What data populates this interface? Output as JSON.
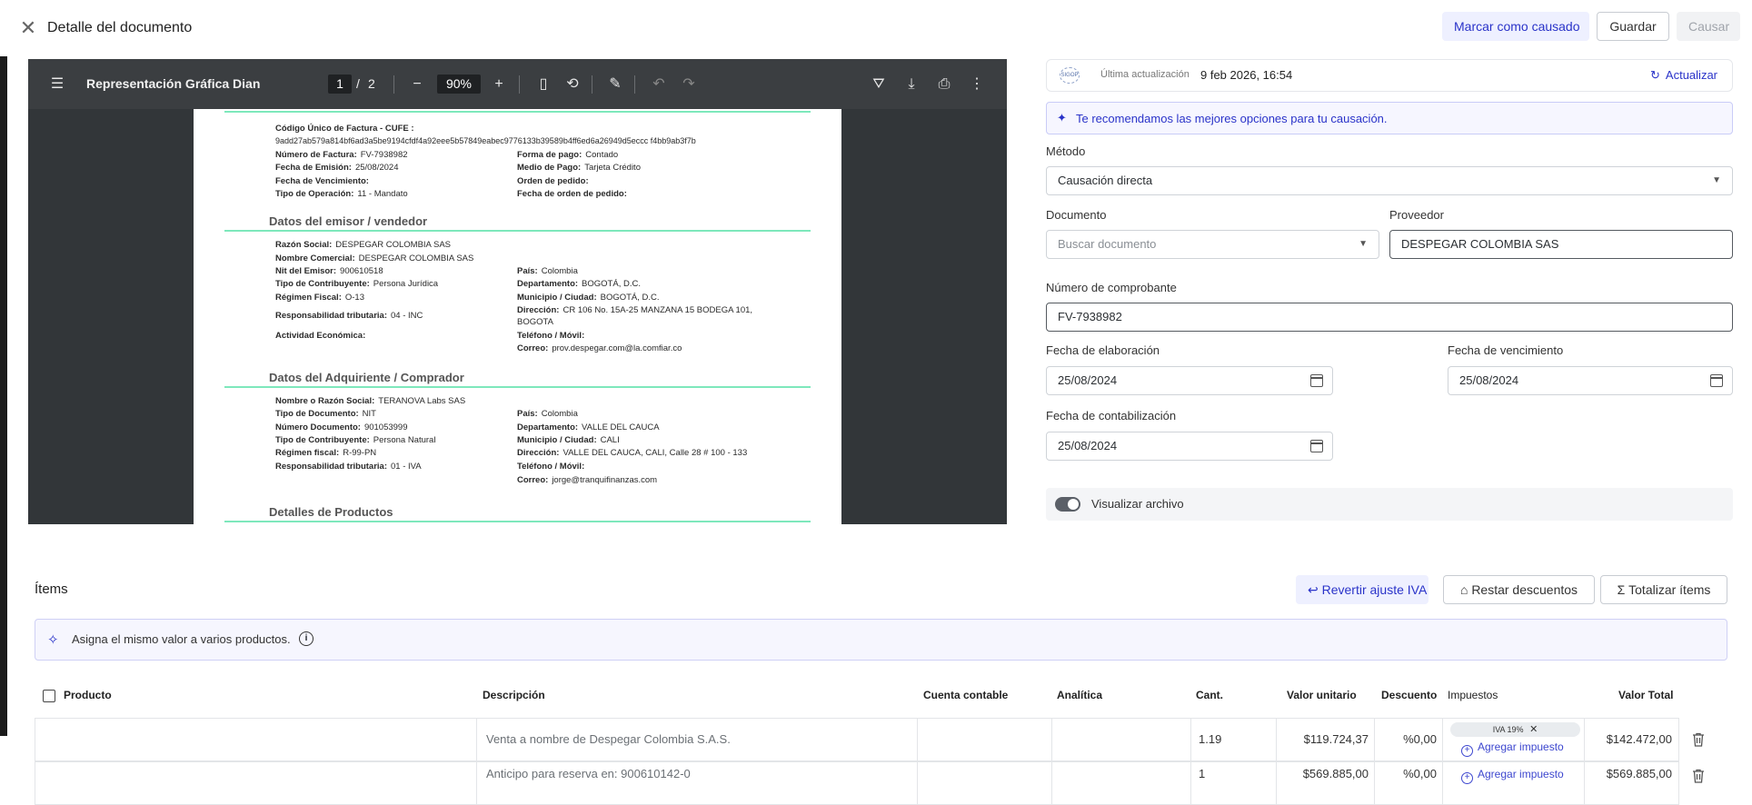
{
  "header": {
    "title": "Detalle del documento",
    "mark_label": "Marcar como causado",
    "save_label": "Guardar",
    "causar_label": "Causar"
  },
  "pdf": {
    "title": "Representación Gráfica Dian",
    "page_current": "1",
    "page_sep": "/",
    "page_total": "2",
    "zoom": "90%",
    "content": {
      "cufe_label": "Código Único de Factura - CUFE :",
      "cufe_value": "9add27ab579a814bf6ad3a5be9194cfdf4a92eee5b57849eabec9776133b39589b4ff6ed6a26949d5eccc f4bb9ab3f7b",
      "num_factura_label": "Número de Factura:",
      "num_factura_value": "FV-7938982",
      "forma_pago_label": "Forma de pago:",
      "forma_pago_value": "Contado",
      "fecha_emision_label": "Fecha de Emisión:",
      "fecha_emision_value": "25/08/2024",
      "medio_pago_label": "Medio de Pago:",
      "medio_pago_value": "Tarjeta Crédito",
      "fecha_venc_label": "Fecha de Vencimiento:",
      "orden_pedido_label": "Orden de pedido:",
      "tipo_operacion_label": "Tipo de Operación:",
      "tipo_operacion_value": "11 - Mandato",
      "fecha_orden_label": "Fecha de orden de pedido:",
      "sec_emisor": "Datos del emisor / vendedor",
      "razon_social_label": "Razón Social:",
      "razon_social_value": "DESPEGAR COLOMBIA SAS",
      "nombre_comercial_label": "Nombre Comercial:",
      "nombre_comercial_value": "DESPEGAR COLOMBIA SAS",
      "nit_label": "Nit del Emisor:",
      "nit_value": "900610518",
      "pais_label": "País:",
      "pais_value": "Colombia",
      "tipo_contrib_label": "Tipo de Contribuyente:",
      "tipo_contrib_value": "Persona Jurídica",
      "depto_label": "Departamento:",
      "depto_value": "BOGOTÁ, D.C.",
      "regimen_label": "Régimen Fiscal:",
      "regimen_value": "O-13",
      "municipio_label": "Municipio / Ciudad:",
      "municipio_value": "BOGOTÁ, D.C.",
      "resp_trib_label": "Responsabilidad tributaria:",
      "resp_trib_value": "04 - INC",
      "direccion_label": "Dirección:",
      "direccion_value": "CR 106 No. 15A-25 MANZANA 15 BODEGA 101,",
      "direccion_value2": "BOGOTA",
      "actividad_label": "Actividad Económica:",
      "telefono_label": "Teléfono / Móvil:",
      "correo_label": "Correo:",
      "correo_value": "prov.despegar.com@la.comfiar.co",
      "sec_adquiriente": "Datos del Adquiriente / Comprador",
      "a_nombre_label": "Nombre o Razón Social:",
      "a_nombre_value": "TERANOVA Labs SAS",
      "a_tipo_doc_label": "Tipo de Documento:",
      "a_tipo_doc_value": "NIT",
      "a_pais_label": "País:",
      "a_pais_value": "Colombia",
      "a_num_doc_label": "Número Documento:",
      "a_num_doc_value": "901053999",
      "a_depto_label": "Departamento:",
      "a_depto_value": "VALLE DEL CAUCA",
      "a_tipo_contrib_label": "Tipo de Contribuyente:",
      "a_tipo_contrib_value": "Persona Natural",
      "a_municipio_label": "Municipio / Ciudad:",
      "a_municipio_value": "CALI",
      "a_regimen_label": "Régimen fiscal:",
      "a_regimen_value": "R-99-PN",
      "a_direccion_label": "Dirección:",
      "a_direccion_value": "VALLE DEL CAUCA, CALI, Calle 28 # 100 - 133",
      "a_resp_label": "Responsabilidad tributaria:",
      "a_resp_value": "01 - IVA",
      "a_telefono_label": "Teléfono / Móvil:",
      "a_correo_label": "Correo:",
      "a_correo_value": "jorge@tranquifinanzas.com",
      "sec_productos": "Detalles de Productos"
    }
  },
  "form": {
    "logo_text": "SIGOP",
    "last_update_label": "Última actualización",
    "last_update_value": "9 feb 2026, 16:54",
    "refresh_label": "Actualizar",
    "recommendation": "Te recomendamos las mejores opciones para tu causación.",
    "method_label": "Método",
    "method_value": "Causación directa",
    "document_label": "Documento",
    "document_placeholder": "Buscar documento",
    "provider_label": "Proveedor",
    "provider_value": "DESPEGAR COLOMBIA SAS",
    "voucher_label": "Número de comprobante",
    "voucher_value": "FV-7938982",
    "elab_label": "Fecha de elaboración",
    "elab_value": "25/08/2024",
    "venc_label": "Fecha de vencimiento",
    "venc_value": "25/08/2024",
    "cont_label": "Fecha de contabilización",
    "cont_value": "25/08/2024",
    "show_file_label": "Visualizar archivo"
  },
  "items": {
    "title": "Ítems",
    "revert_label": "Revertir ajuste IVA",
    "discounts_label": "Restar descuentos",
    "totalize_label": "Totalizar ítems",
    "assign_text": "Asigna el mismo valor a varios productos.",
    "columns": {
      "producto": "Producto",
      "descripcion": "Descripción",
      "cuenta": "Cuenta contable",
      "analitica": "Analítica",
      "cant": "Cant.",
      "valor_unitario": "Valor unitario",
      "descuento": "Descuento",
      "impuestos": "Impuestos",
      "valor_total": "Valor Total"
    },
    "rows": [
      {
        "descripcion": "Venta a nombre de Despegar Colombia S.A.S.",
        "cant": "1.19",
        "valor_unitario": "$119.724,37",
        "descuento": "%0,00",
        "tax_chip": "IVA 19%",
        "add_tax": "Agregar impuesto",
        "valor_total": "$142.472,00"
      },
      {
        "descripcion": "Anticipo para reserva en: 900610142-0",
        "cant": "1",
        "valor_unitario": "$569.885,00",
        "descuento": "%0,00",
        "add_tax": "Agregar impuesto",
        "valor_total": "$569.885,00"
      }
    ]
  }
}
